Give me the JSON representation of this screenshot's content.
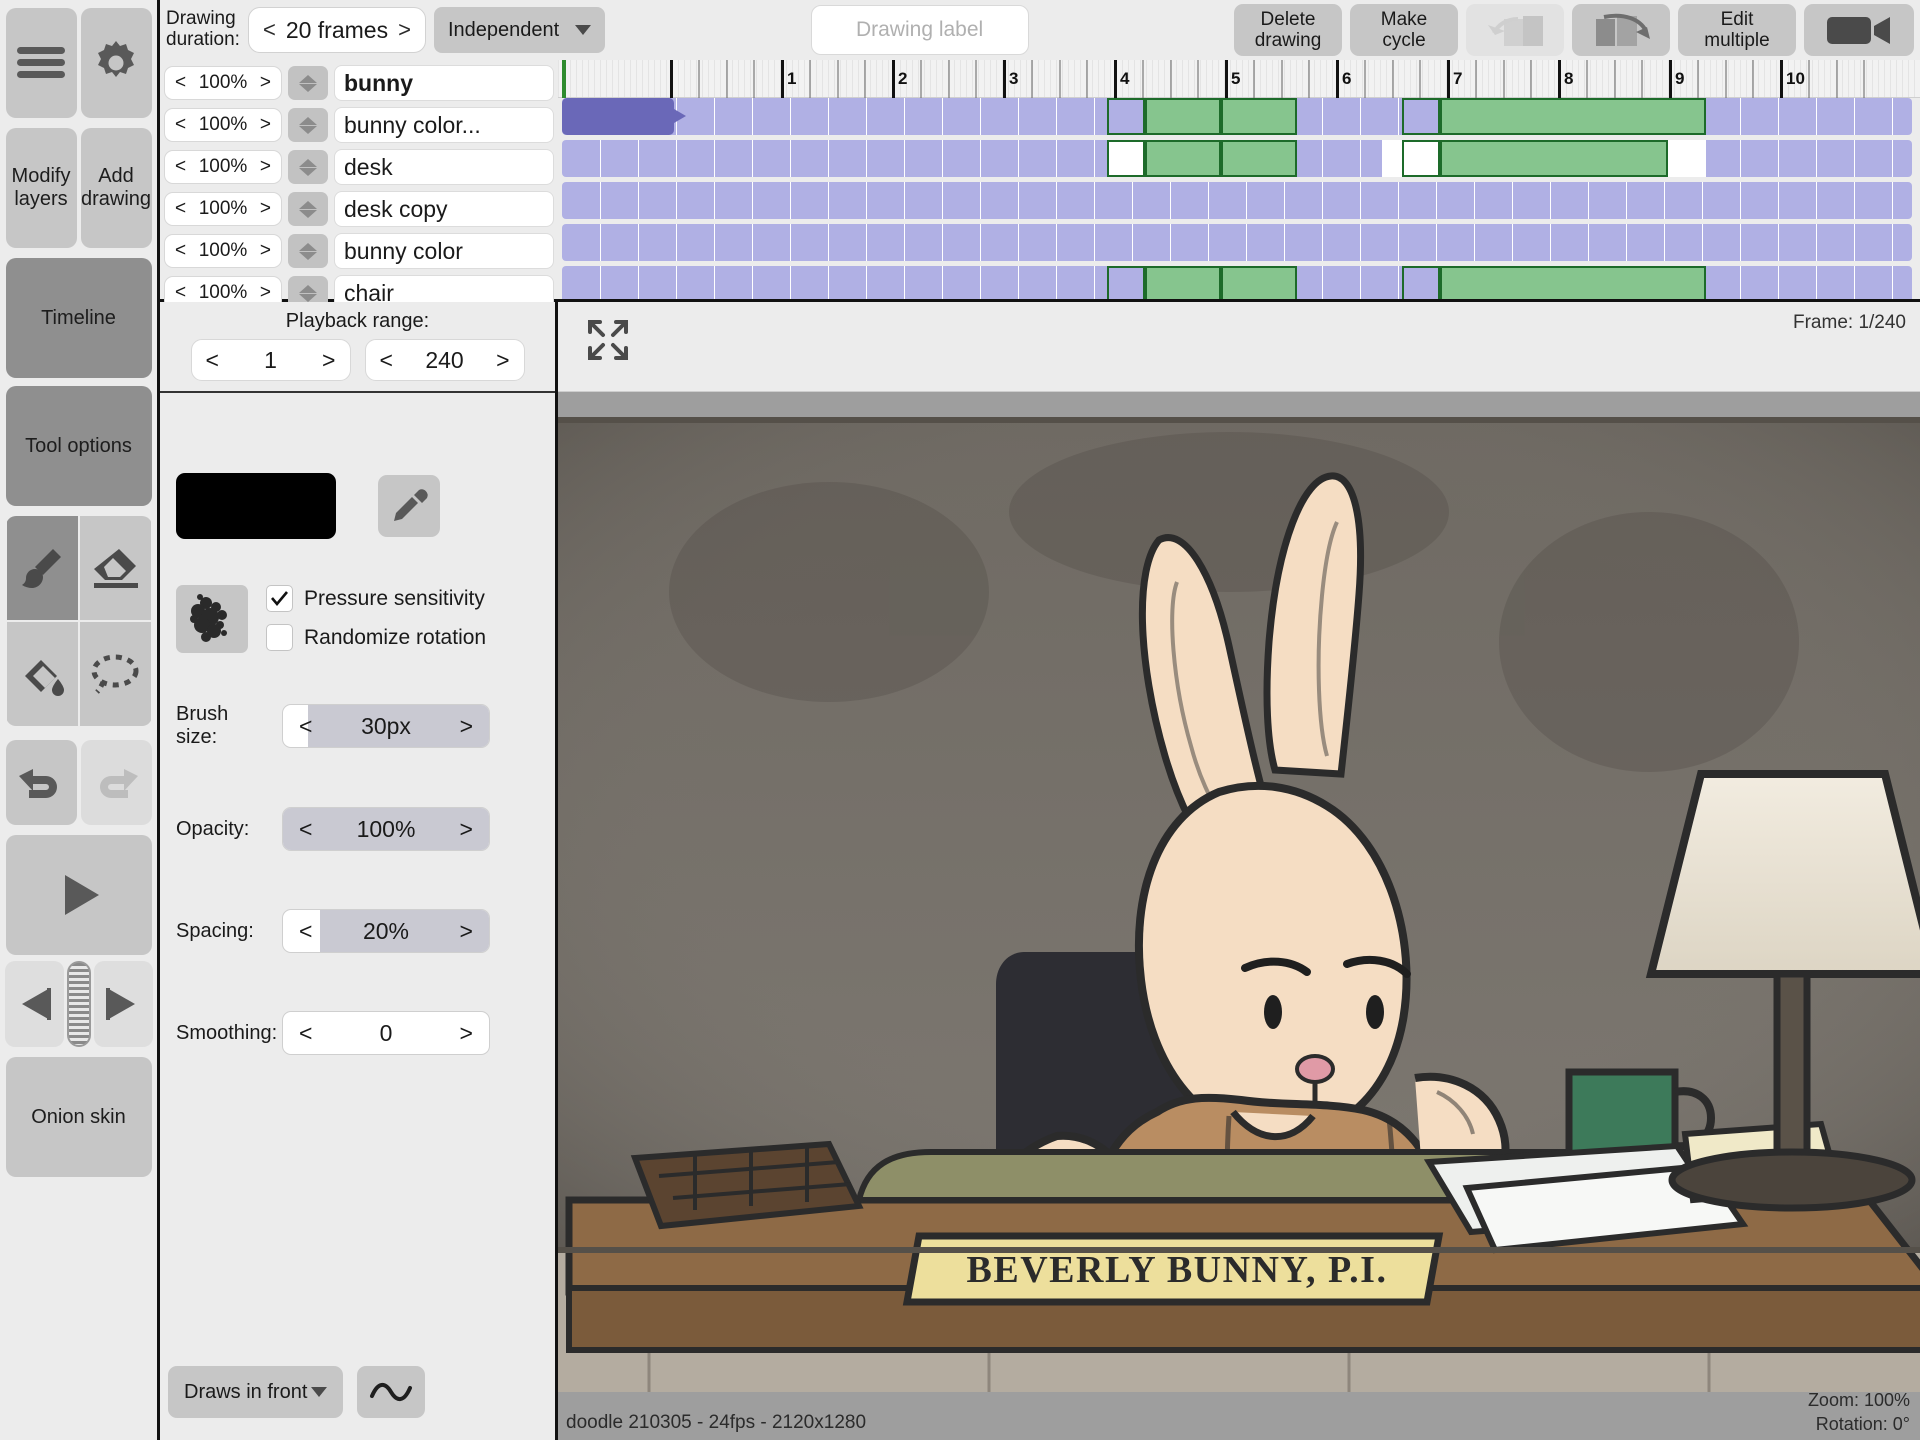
{
  "sidebar": {
    "menu_icon": "hamburger-icon",
    "settings_icon": "gear-icon",
    "modify_layers": "Modify\nlayers",
    "add_drawing": "Add\ndrawing",
    "timeline": "Timeline",
    "tool_options": "Tool options",
    "onion_skin": "Onion skin",
    "tools": [
      {
        "name": "brush-tool",
        "selected": true
      },
      {
        "name": "eraser-tool",
        "selected": false
      },
      {
        "name": "bucket-fill-tool",
        "selected": false
      },
      {
        "name": "lasso-select-tool",
        "selected": false
      }
    ],
    "undo": "undo-icon",
    "redo": "redo-icon",
    "play": "play-icon",
    "prev_frame": "previous-frame-icon",
    "next_frame": "next-frame-icon"
  },
  "toolbar": {
    "duration_label": "Drawing\nduration:",
    "duration_value": "20 frames",
    "prev": "<",
    "next": ">",
    "cycle_mode": "Independent",
    "drawing_label_placeholder": "Drawing label",
    "drawing_label_value": "",
    "delete_drawing": "Delete\ndrawing",
    "make_cycle": "Make\ncycle",
    "rotate_left_icon": "rotate-left-icon",
    "rotate_right_icon": "rotate-right-icon",
    "edit_multiple": "Edit\nmultiple",
    "camera_icon": "camera-icon"
  },
  "timeline": {
    "ruler_numbers": [
      "1",
      "2",
      "3",
      "4",
      "5",
      "6",
      "7",
      "8",
      "9",
      "10"
    ],
    "playhead_frame": 1,
    "layers": [
      {
        "opacity": "100%",
        "name": "bunny",
        "selected": true
      },
      {
        "opacity": "100%",
        "name": "bunny color...",
        "selected": false
      },
      {
        "opacity": "100%",
        "name": "desk",
        "selected": false
      },
      {
        "opacity": "100%",
        "name": "desk copy",
        "selected": false
      },
      {
        "opacity": "100%",
        "name": "bunny color",
        "selected": false
      },
      {
        "opacity": "100%",
        "name": "chair",
        "selected": false
      }
    ]
  },
  "playback": {
    "range_title": "Playback range:",
    "start": "1",
    "end": "240",
    "prev": "<",
    "next": ">"
  },
  "tool_options": {
    "color_swatch": "#000000",
    "eyedropper_icon": "eyedropper-icon",
    "brush_preview_icon": "brush-texture-icon",
    "pressure_sensitivity_label": "Pressure sensitivity",
    "pressure_sensitivity_checked": true,
    "randomize_rotation_label": "Randomize rotation",
    "randomize_rotation_checked": false,
    "params": [
      {
        "label": "Brush size:",
        "value": "30px",
        "fill_pct": 12
      },
      {
        "label": "Opacity:",
        "value": "100%",
        "fill_pct": 0
      },
      {
        "label": "Spacing:",
        "value": "20%",
        "fill_pct": 18
      },
      {
        "label": "Smoothing:",
        "value": "0",
        "fill_pct": 100
      }
    ],
    "draw_order": "Draws in front",
    "smooth_curve_icon": "wave-icon"
  },
  "canvas": {
    "expand_icon": "expand-icon",
    "frame_counter": "Frame: 1/240",
    "status_left": "doodle 210305 - 24fps - 2120x1280",
    "zoom": "Zoom: 100%",
    "rotation": "Rotation: 0°",
    "sign_text": "BEVERLY BUNNY, P.I."
  },
  "colors": {
    "track_lavender": "#b0b0e4",
    "keyframe_green": "#86c58e",
    "keyframe_border": "#1d6b2a",
    "selection_purple": "#6a68b8",
    "playhead_green": "#2e8b2e",
    "panel_gray": "#ececec",
    "button_gray": "#c6c6c6",
    "active_gray": "#8f8f8f"
  }
}
